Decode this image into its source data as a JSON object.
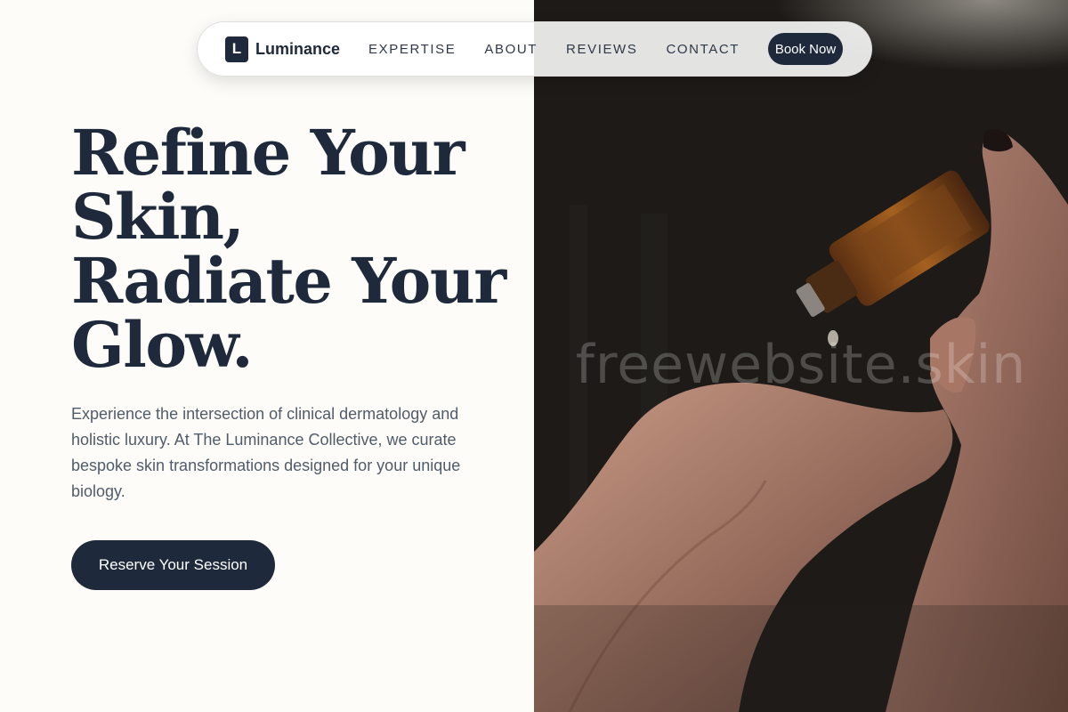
{
  "nav": {
    "logo_letter": "L",
    "logo_text": "Luminance",
    "links": [
      "EXPERTISE",
      "ABOUT",
      "REVIEWS",
      "CONTACT"
    ],
    "cta_label": "Book Now"
  },
  "hero": {
    "title_lines": [
      "Refine Your",
      "Skin,",
      "Radiate Your",
      "Glow."
    ],
    "description": "Experience the intersection of clinical dermatology and holistic luxury. At The Luminance Collective, we curate bespoke skin transformations designed for your unique biology.",
    "cta_label": "Reserve Your Session"
  },
  "photo": {
    "watermark": "freewebsite.skin"
  },
  "colors": {
    "accent": "#1e293b",
    "background": "#fdfcf8",
    "body_text": "#515c6b"
  }
}
